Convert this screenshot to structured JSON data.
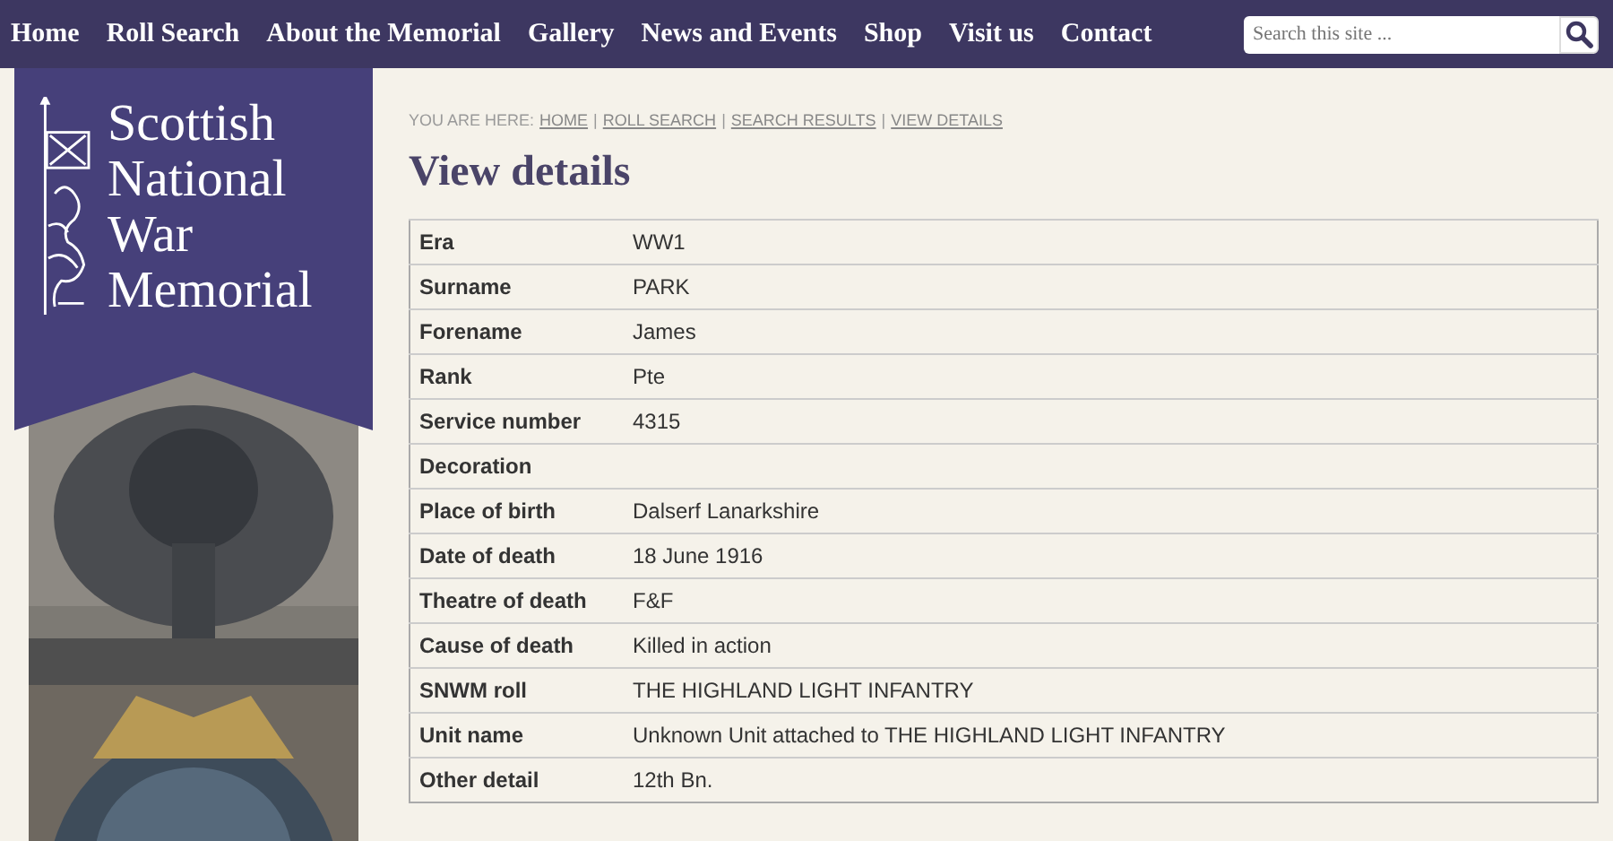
{
  "nav": {
    "items": [
      {
        "label": "Home"
      },
      {
        "label": "Roll Search"
      },
      {
        "label": "About the Memorial"
      },
      {
        "label": "Gallery"
      },
      {
        "label": "News and Events"
      },
      {
        "label": "Shop"
      },
      {
        "label": "Visit us"
      },
      {
        "label": "Contact"
      }
    ],
    "search": {
      "placeholder": "Search this site ..."
    }
  },
  "sidebar": {
    "logo_lines": [
      "Scottish",
      "National",
      "War",
      "Memorial"
    ]
  },
  "breadcrumb": {
    "prefix": "YOU ARE HERE:",
    "separator": "|",
    "links": [
      "HOME",
      "ROLL SEARCH",
      "SEARCH RESULTS",
      "VIEW DETAILS"
    ]
  },
  "heading": "View details",
  "details": [
    {
      "label": "Era",
      "value": "WW1"
    },
    {
      "label": "Surname",
      "value": "PARK"
    },
    {
      "label": "Forename",
      "value": "James"
    },
    {
      "label": "Rank",
      "value": "Pte"
    },
    {
      "label": "Service number",
      "value": "4315"
    },
    {
      "label": "Decoration"
    },
    {
      "label": "Place of birth",
      "value": "Dalserf Lanarkshire"
    },
    {
      "label": "Date of death",
      "value": "18 June 1916"
    },
    {
      "label": "Theatre of death",
      "value": "F&F"
    },
    {
      "label": "Cause of death",
      "value": "Killed in action"
    },
    {
      "label": "SNWM roll",
      "value": "THE HIGHLAND LIGHT INFANTRY"
    },
    {
      "label": "Unit name",
      "value": "Unknown Unit attached to THE HIGHLAND LIGHT INFANTRY"
    },
    {
      "label": "Other detail",
      "value": "12th Bn."
    }
  ]
}
